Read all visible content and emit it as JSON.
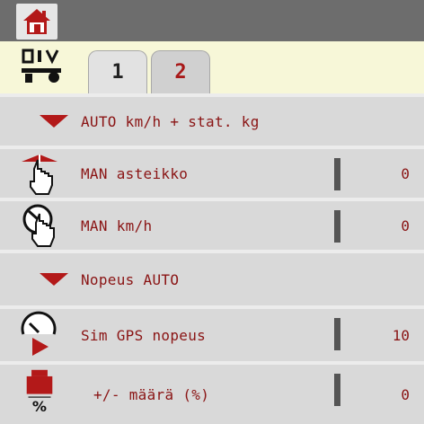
{
  "header": {
    "home_icon": "home-icon"
  },
  "settings": {
    "icon": "tools-icon"
  },
  "tabs": [
    {
      "label": "1",
      "active": true
    },
    {
      "label": "2",
      "active": false
    }
  ],
  "colors": {
    "text": "#8a1414",
    "accent": "#b31919",
    "topbar": "#6d6d6d",
    "tab_bg": "#f7f7d8"
  },
  "rows": [
    {
      "type": "group",
      "label": "AUTO km/h + stat. kg",
      "icon": "triangle-down-icon"
    },
    {
      "type": "item",
      "label": "MAN asteikko",
      "value": "0",
      "icon": "man-scale-icon"
    },
    {
      "type": "item",
      "label": "MAN km/h",
      "value": "0",
      "icon": "man-speed-icon"
    },
    {
      "type": "group",
      "label": "Nopeus AUTO",
      "icon": "triangle-down-icon"
    },
    {
      "type": "item",
      "label": "Sim GPS nopeus",
      "value": "10",
      "icon": "sim-gps-icon"
    },
    {
      "type": "item",
      "label": "+/- määrä (%)",
      "value": "0",
      "icon": "quantity-percent-icon"
    }
  ]
}
